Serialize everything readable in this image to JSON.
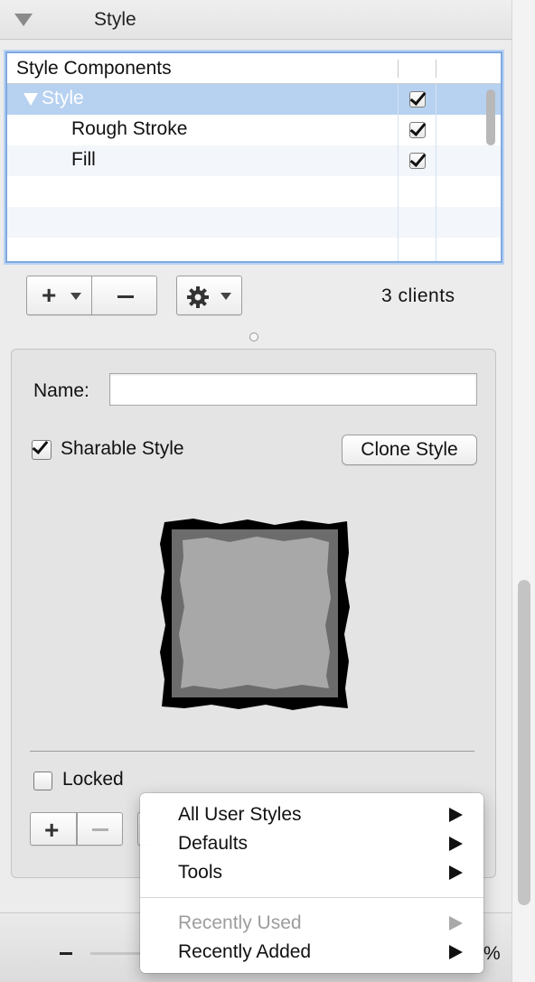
{
  "header": {
    "title": "Style"
  },
  "components_table": {
    "column_header": "Style Components",
    "rows": [
      {
        "label": "Style",
        "checked": true,
        "selected": true,
        "level": 0,
        "expanded": true
      },
      {
        "label": "Rough Stroke",
        "checked": true,
        "selected": false,
        "level": 1
      },
      {
        "label": "Fill",
        "checked": true,
        "selected": false,
        "level": 1
      }
    ]
  },
  "toolbar": {
    "clients_text": "3  clients"
  },
  "style_panel": {
    "name_label": "Name:",
    "name_value": "",
    "sharable_label": "Sharable Style",
    "sharable_checked": true,
    "clone_button": "Clone Style",
    "locked_label": "Locked",
    "locked_checked": false
  },
  "popup_menu": {
    "items": [
      {
        "label": "All User Styles",
        "submenu": true,
        "enabled": true
      },
      {
        "label": "Defaults",
        "submenu": true,
        "enabled": true
      },
      {
        "label": "Tools",
        "submenu": true,
        "enabled": true
      },
      {
        "label": "Recently Used",
        "submenu": true,
        "enabled": false
      },
      {
        "label": "Recently Added",
        "submenu": true,
        "enabled": true
      }
    ]
  },
  "bottom_bar": {
    "zoom_text": "%"
  },
  "colors": {
    "selection": "#b7d1f0",
    "focus_ring": "#7fa9e0",
    "disabled_text": "#9d9d9d"
  }
}
